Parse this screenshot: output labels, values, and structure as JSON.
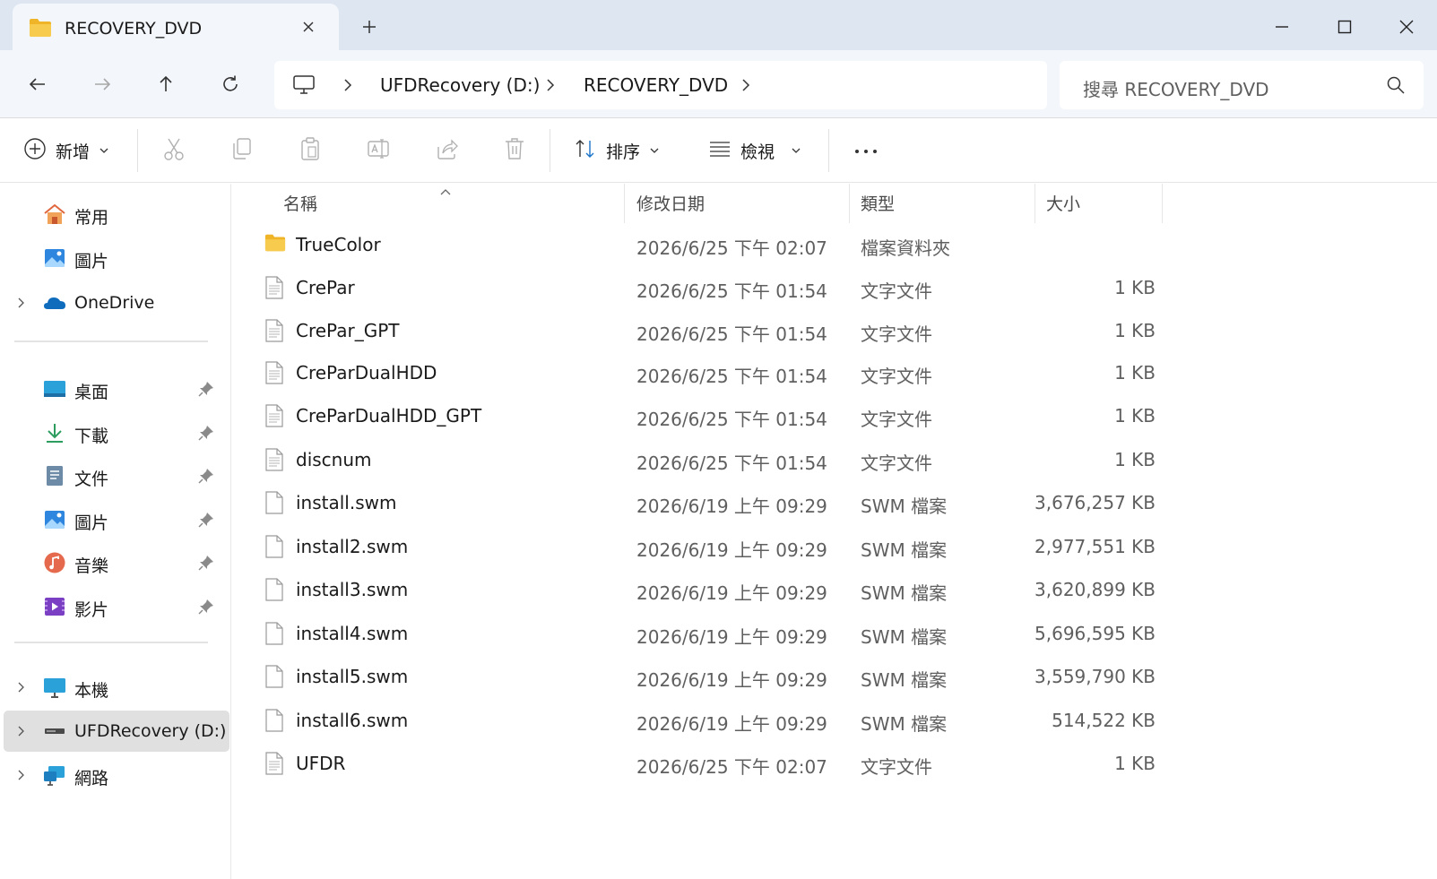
{
  "window": {
    "tab_title": "RECOVERY_DVD",
    "new_tab_label": "+"
  },
  "address": {
    "crumbs": [
      "UFDRecovery (D:)",
      "RECOVERY_DVD"
    ],
    "search_placeholder": "搜尋 RECOVERY_DVD"
  },
  "toolbar": {
    "new_label": "新增",
    "sort_label": "排序",
    "view_label": "檢視",
    "more_label": "···"
  },
  "sidebar": {
    "items": [
      {
        "label": "常用",
        "icon": "home-icon"
      },
      {
        "label": "圖片",
        "icon": "pictures-icon"
      },
      {
        "label": "OneDrive",
        "icon": "onedrive-icon"
      },
      {
        "label": "桌面",
        "icon": "desktop-icon"
      },
      {
        "label": "下載",
        "icon": "download-icon"
      },
      {
        "label": "文件",
        "icon": "documents-icon"
      },
      {
        "label": "圖片",
        "icon": "pictures-icon"
      },
      {
        "label": "音樂",
        "icon": "music-icon"
      },
      {
        "label": "影片",
        "icon": "videos-icon"
      },
      {
        "label": "本機",
        "icon": "this-pc-icon"
      },
      {
        "label": "UFDRecovery (D:)",
        "icon": "drive-icon"
      },
      {
        "label": "網路",
        "icon": "network-icon"
      }
    ]
  },
  "columns": {
    "name": "名稱",
    "date": "修改日期",
    "type": "類型",
    "size": "大小"
  },
  "files": [
    {
      "name": "TrueColor",
      "date": "2026/6/25 下午 02:07",
      "type": "檔案資料夾",
      "size": "",
      "icon": "folder-icon"
    },
    {
      "name": "CrePar",
      "date": "2026/6/25 下午 01:54",
      "type": "文字文件",
      "size": "1 KB",
      "icon": "text-file-icon"
    },
    {
      "name": "CrePar_GPT",
      "date": "2026/6/25 下午 01:54",
      "type": "文字文件",
      "size": "1 KB",
      "icon": "text-file-icon"
    },
    {
      "name": "CreParDualHDD",
      "date": "2026/6/25 下午 01:54",
      "type": "文字文件",
      "size": "1 KB",
      "icon": "text-file-icon"
    },
    {
      "name": "CreParDualHDD_GPT",
      "date": "2026/6/25 下午 01:54",
      "type": "文字文件",
      "size": "1 KB",
      "icon": "text-file-icon"
    },
    {
      "name": "discnum",
      "date": "2026/6/25 下午 01:54",
      "type": "文字文件",
      "size": "1 KB",
      "icon": "text-file-icon"
    },
    {
      "name": "install.swm",
      "date": "2026/6/19 上午 09:29",
      "type": "SWM 檔案",
      "size": "3,676,257 KB",
      "icon": "blank-file-icon"
    },
    {
      "name": "install2.swm",
      "date": "2026/6/19 上午 09:29",
      "type": "SWM 檔案",
      "size": "2,977,551 KB",
      "icon": "blank-file-icon"
    },
    {
      "name": "install3.swm",
      "date": "2026/6/19 上午 09:29",
      "type": "SWM 檔案",
      "size": "3,620,899 KB",
      "icon": "blank-file-icon"
    },
    {
      "name": "install4.swm",
      "date": "2026/6/19 上午 09:29",
      "type": "SWM 檔案",
      "size": "5,696,595 KB",
      "icon": "blank-file-icon"
    },
    {
      "name": "install5.swm",
      "date": "2026/6/19 上午 09:29",
      "type": "SWM 檔案",
      "size": "3,559,790 KB",
      "icon": "blank-file-icon"
    },
    {
      "name": "install6.swm",
      "date": "2026/6/19 上午 09:29",
      "type": "SWM 檔案",
      "size": "514,522 KB",
      "icon": "blank-file-icon"
    },
    {
      "name": "UFDR",
      "date": "2026/6/25 下午 02:07",
      "type": "文字文件",
      "size": "1 KB",
      "icon": "text-file-icon"
    }
  ],
  "colors": {
    "titlebar": "#dde6f1",
    "navbar": "#f3f6fb",
    "selected_sidebar": "#e0e0e0",
    "folder": "#f5c342",
    "accent": "#1a73c9"
  }
}
